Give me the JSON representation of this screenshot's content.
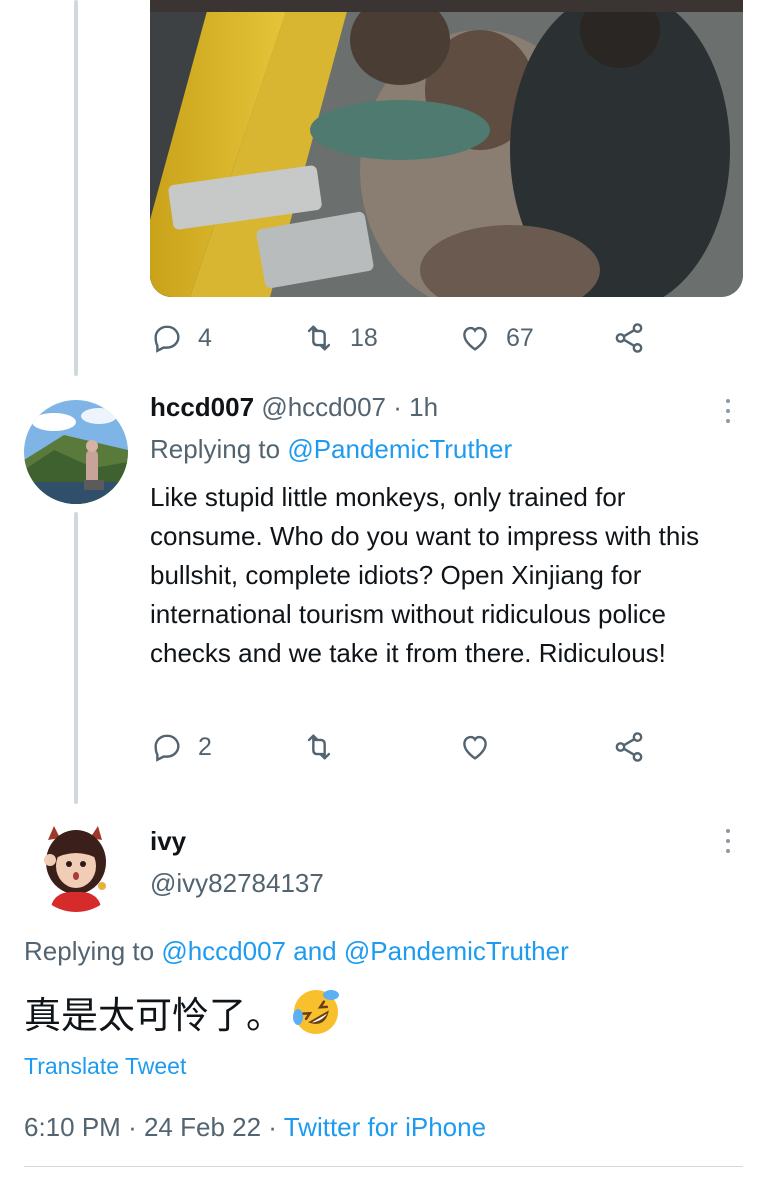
{
  "colors": {
    "accent": "#1d9bf0",
    "muted": "#536471",
    "line": "#cfd9de"
  },
  "parent_tweet": {
    "media_icon": "video-frame",
    "actions": {
      "replies": "4",
      "retweets": "18",
      "likes": "67"
    }
  },
  "reply": {
    "display_name": "hccd007",
    "handle": "@hccd007",
    "separator": "·",
    "time": "1h",
    "replying_prefix": "Replying to",
    "replying_to": "@PandemicTruther",
    "text": "Like stupid little monkeys, only trained for consume. Who do you want to impress with this bullshit, complete idiots? Open Xinjiang for international tourism without ridiculous police checks and we take it from there. Ridiculous!",
    "actions": {
      "replies": "2",
      "retweets": "",
      "likes": ""
    }
  },
  "main_tweet": {
    "display_name": "ivy",
    "handle": "@ivy82784137",
    "replying_prefix": "Replying to",
    "replying_to_1": "@hccd007",
    "replying_and": "and",
    "replying_to_2": "@PandemicTruther",
    "text": "真是太可怜了。",
    "emoji": "rolling-on-floor-laughing",
    "translate_label": "Translate Tweet",
    "time": "6:10 PM",
    "separator": "·",
    "date": "24 Feb 22",
    "source": "Twitter for iPhone"
  }
}
